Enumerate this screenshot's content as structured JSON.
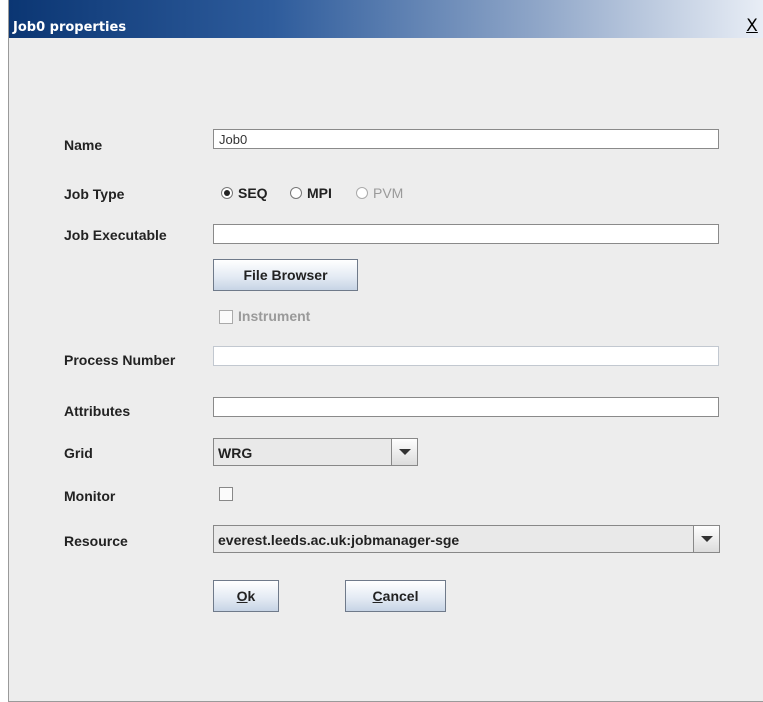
{
  "window": {
    "title": "Job0 properties",
    "close_glyph": "X"
  },
  "labels": {
    "name": "Name",
    "job_type": "Job Type",
    "job_executable": "Job Executable",
    "process_number": "Process Number",
    "attributes": "Attributes",
    "grid": "Grid",
    "monitor": "Monitor",
    "resource": "Resource"
  },
  "fields": {
    "name_value": "Job0",
    "job_executable_value": "",
    "process_number_value": "",
    "attributes_value": ""
  },
  "job_type": {
    "options": [
      {
        "label": "SEQ",
        "selected": true,
        "enabled": true
      },
      {
        "label": "MPI",
        "selected": false,
        "enabled": true
      },
      {
        "label": "PVM",
        "selected": false,
        "enabled": false
      }
    ]
  },
  "buttons": {
    "file_browser": "File Browser",
    "ok_mnemonic": "O",
    "ok_rest": "k",
    "cancel_mnemonic": "C",
    "cancel_rest": "ancel"
  },
  "instrument": {
    "label": "Instrument",
    "checked": false,
    "enabled": false
  },
  "monitor": {
    "checked": false
  },
  "grid": {
    "selected": "WRG"
  },
  "resource": {
    "selected": "everest.leeds.ac.uk:jobmanager-sge"
  }
}
